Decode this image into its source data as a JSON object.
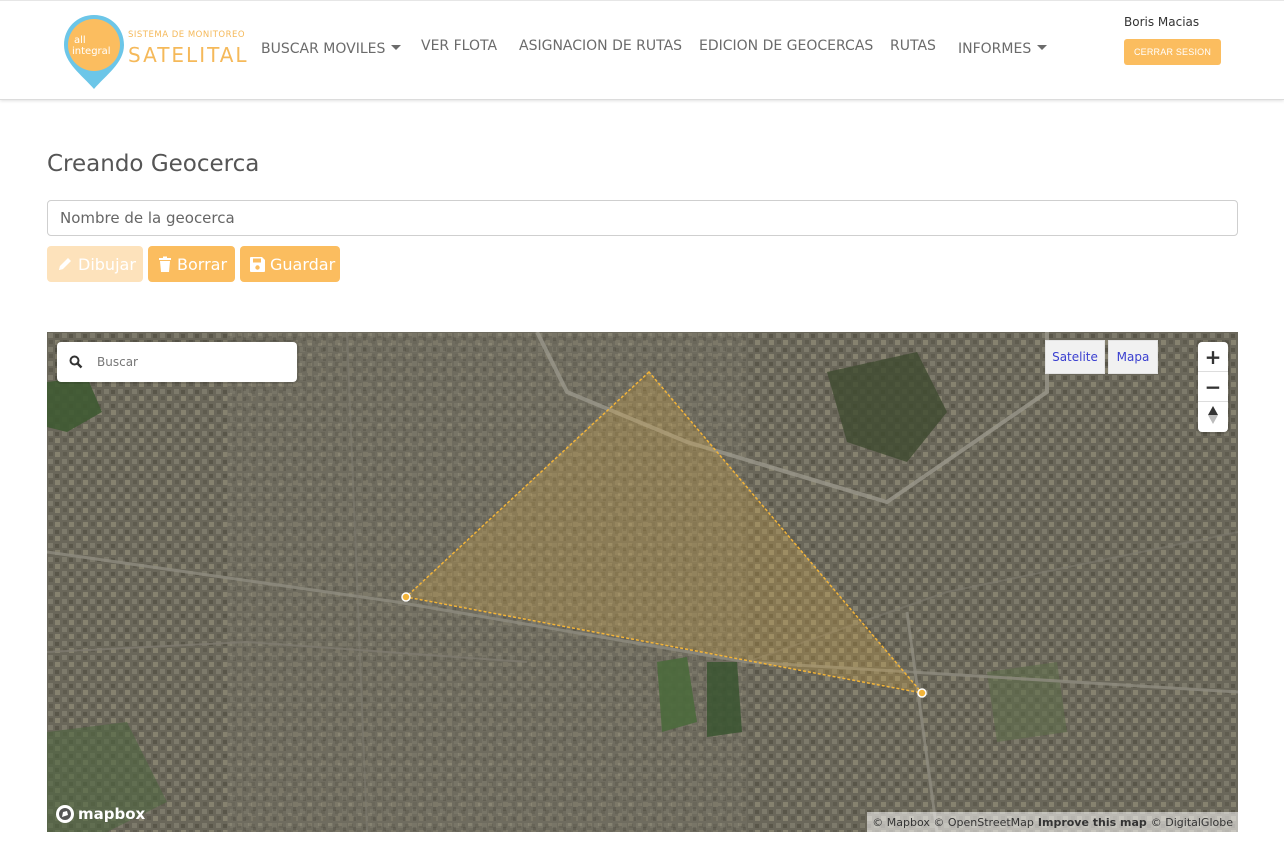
{
  "header": {
    "logo": {
      "pin_line1": "all",
      "pin_line2": "integral",
      "subtitle": "SISTEMA DE MONITOREO",
      "title": "SATELITAL"
    },
    "nav": [
      {
        "label": "BUSCAR MOVILES",
        "dropdown": true
      },
      {
        "label": "VER FLOTA",
        "dropdown": false
      },
      {
        "label": "ASIGNACION DE RUTAS",
        "dropdown": false
      },
      {
        "label": "EDICION DE GEOCERCAS",
        "dropdown": false
      },
      {
        "label": "RUTAS",
        "dropdown": false
      },
      {
        "label": "INFORMES",
        "dropdown": true
      }
    ],
    "user_name": "Boris Macias",
    "logout_label": "CERRAR SESION"
  },
  "page": {
    "title": "Creando Geocerca",
    "name_input": {
      "placeholder": "Nombre de la geocerca",
      "value": ""
    },
    "buttons": {
      "draw": "Dibujar",
      "delete": "Borrar",
      "save": "Guardar"
    }
  },
  "map": {
    "search_placeholder": "Buscar",
    "layer_satellite": "Satelite",
    "layer_map": "Mapa",
    "zoom_in": "+",
    "zoom_out": "−",
    "compass": "compass-icon",
    "mapbox_logo": "mapbox",
    "attribution": {
      "mapbox": "© Mapbox",
      "osm": "© OpenStreetMap",
      "improve": "Improve this map",
      "digitalglobe": "© DigitalGlobe"
    }
  },
  "colors": {
    "accent": "#fbbd5f",
    "accent_disabled": "#fde2bb",
    "geofence": "#f2b43a"
  }
}
